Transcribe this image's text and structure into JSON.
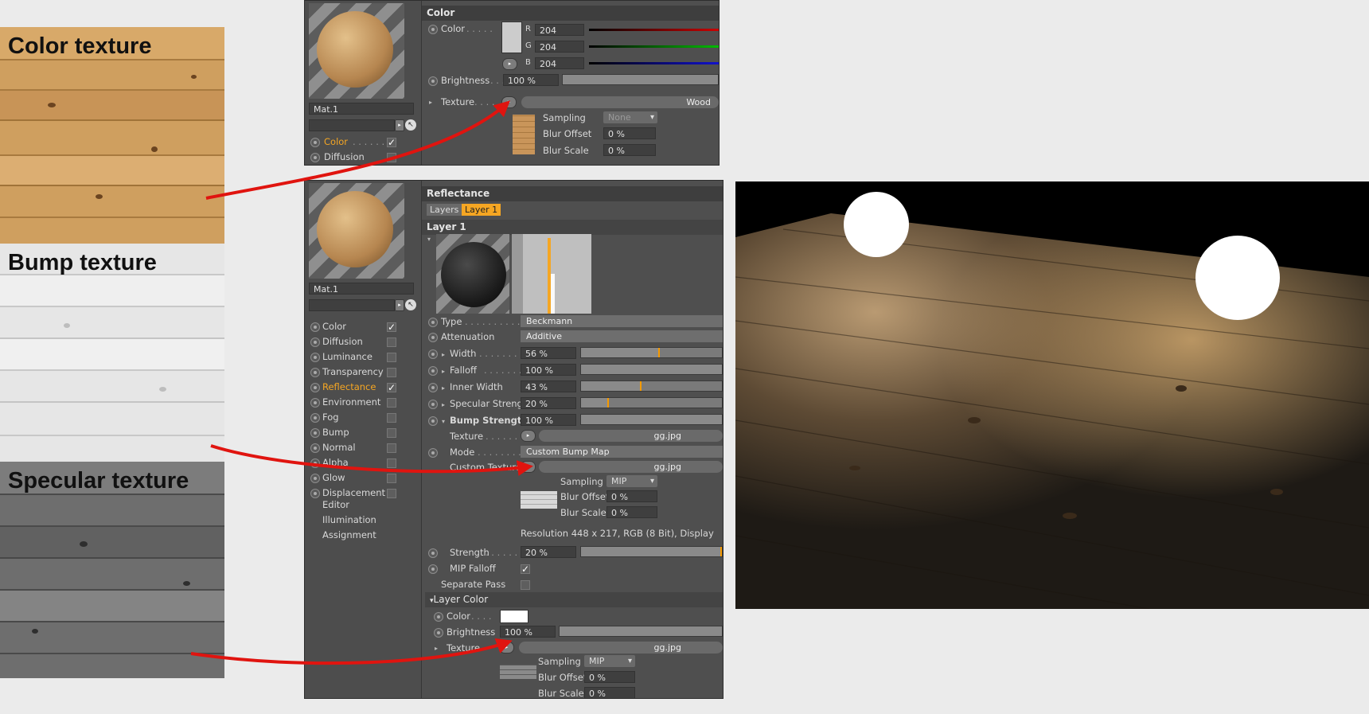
{
  "textures": {
    "color_label": "Color texture",
    "bump_label": "Bump texture",
    "specular_label": "Specular texture"
  },
  "top_panel": {
    "material_name": "Mat.1",
    "channels": [
      {
        "label": "Color",
        "checked": true,
        "active": true
      },
      {
        "label": "Diffusion",
        "checked": false,
        "active": false
      }
    ],
    "section_title": "Color",
    "color_label": "Color",
    "r_label": "R",
    "r_value": "204",
    "g_label": "G",
    "g_value": "204",
    "b_label": "B",
    "b_value": "204",
    "brightness_label": "Brightness",
    "brightness_value": "100 %",
    "texture_label": "Texture",
    "texture_name": "Wood",
    "sampling_label": "Sampling",
    "sampling_value": "None",
    "blur_offset_label": "Blur Offset",
    "blur_offset_value": "0 %",
    "blur_scale_label": "Blur Scale",
    "blur_scale_value": "0 %"
  },
  "bottom_panel": {
    "material_name": "Mat.1",
    "channels": [
      {
        "label": "Color",
        "checked": true
      },
      {
        "label": "Diffusion",
        "checked": false
      },
      {
        "label": "Luminance",
        "checked": false
      },
      {
        "label": "Transparency",
        "checked": false
      },
      {
        "label": "Reflectance",
        "checked": true,
        "active": true
      },
      {
        "label": "Environment",
        "checked": false
      },
      {
        "label": "Fog",
        "checked": false
      },
      {
        "label": "Bump",
        "checked": false
      },
      {
        "label": "Normal",
        "checked": false
      },
      {
        "label": "Alpha",
        "checked": false
      },
      {
        "label": "Glow",
        "checked": false
      },
      {
        "label": "Displacement",
        "checked": false
      }
    ],
    "extra_items": [
      "Editor",
      "Illumination",
      "Assignment"
    ],
    "section_title": "Reflectance",
    "tab_layers": "Layers",
    "tab_layer1": "Layer 1",
    "layer_header": "Layer 1",
    "type_label": "Type",
    "type_value": "Beckmann",
    "attenuation_label": "Attenuation",
    "attenuation_value": "Additive",
    "width_label": "Width",
    "width_value": "56 %",
    "width_pct": 56,
    "falloff_label": "Falloff",
    "falloff_value": "100 %",
    "inner_width_label": "Inner Width",
    "inner_width_value": "43 %",
    "inner_width_pct": 43,
    "specular_strength_label": "Specular Strength",
    "specular_strength_value": "20 %",
    "specular_strength_pct": 20,
    "bump_strength_label": "Bump Strength",
    "bump_strength_value": "100 %",
    "texture_label": "Texture",
    "texture_value": "gg.jpg",
    "mode_label": "Mode",
    "mode_value": "Custom Bump Map",
    "custom_texture_label": "Custom Texture",
    "custom_texture_value": "gg.jpg",
    "sampling_label": "Sampling",
    "sampling_value": "MIP",
    "blur_offset_label": "Blur Offset",
    "blur_offset_value": "0 %",
    "blur_scale_label": "Blur Scale",
    "blur_scale_value": "0 %",
    "resolution_text": "Resolution 448 x 217, RGB (8 Bit), Display",
    "strength_label": "Strength",
    "strength_value": "20 %",
    "strength_pct": 100,
    "mip_falloff_label": "MIP Falloff",
    "separate_pass_label": "Separate Pass",
    "layer_color_header": "Layer Color",
    "lc_color_label": "Color",
    "lc_brightness_label": "Brightness",
    "lc_brightness_value": "100 %",
    "lc_texture_label": "Texture",
    "lc_texture_value": "gg.jpg",
    "lc_sampling_label": "Sampling",
    "lc_sampling_value": "MIP",
    "lc_blur_offset_label": "Blur Offset",
    "lc_blur_offset_value": "0 %",
    "lc_blur_scale_label": "Blur Scale",
    "lc_blur_scale_value": "0 %"
  },
  "colors": {
    "accent_orange": "#f5a623",
    "arrow_red": "#e0140f"
  }
}
